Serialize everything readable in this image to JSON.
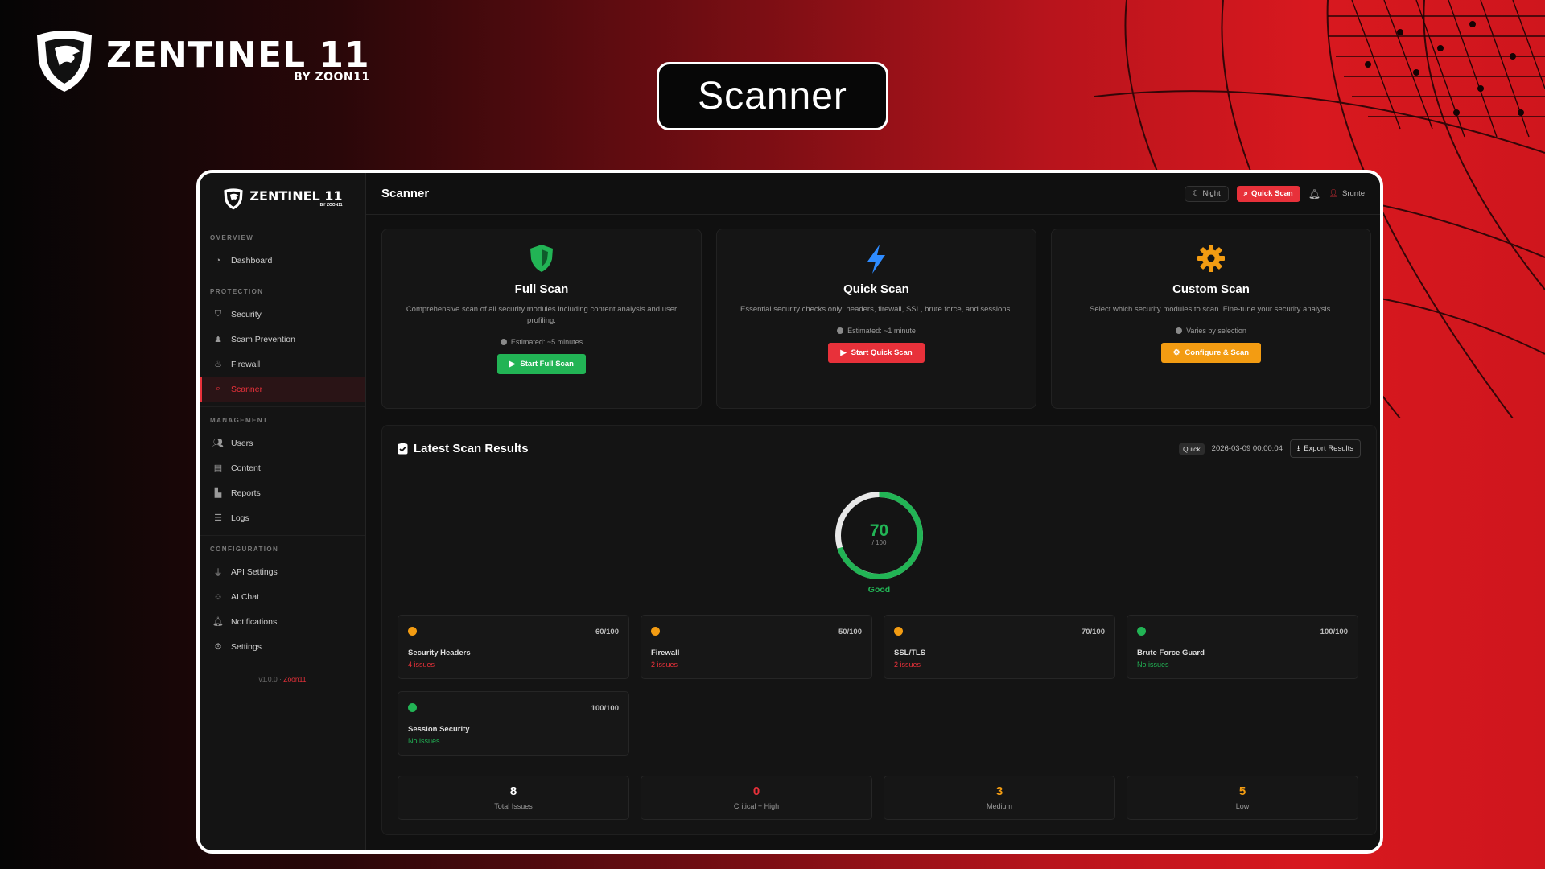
{
  "brand": {
    "name": "ZENTINEL 11",
    "sub": "BY ZOON11"
  },
  "hero_title": "Scanner",
  "sidebar": {
    "logo_name": "ZENTINEL 11",
    "logo_sub": "BY ZOON11",
    "sections": [
      {
        "heading": "OVERVIEW",
        "items": [
          {
            "label": "Dashboard",
            "icon": "dashboard-icon"
          }
        ]
      },
      {
        "heading": "PROTECTION",
        "items": [
          {
            "label": "Security",
            "icon": "shield-icon"
          },
          {
            "label": "Scam Prevention",
            "icon": "user-secret-icon"
          },
          {
            "label": "Firewall",
            "icon": "fire-icon"
          },
          {
            "label": "Scanner",
            "icon": "search-icon",
            "active": true
          }
        ]
      },
      {
        "heading": "MANAGEMENT",
        "items": [
          {
            "label": "Users",
            "icon": "users-icon"
          },
          {
            "label": "Content",
            "icon": "file-icon"
          },
          {
            "label": "Reports",
            "icon": "chart-icon"
          },
          {
            "label": "Logs",
            "icon": "list-icon"
          }
        ]
      },
      {
        "heading": "CONFIGURATION",
        "items": [
          {
            "label": "API Settings",
            "icon": "plug-icon"
          },
          {
            "label": "AI Chat",
            "icon": "robot-icon"
          },
          {
            "label": "Notifications",
            "icon": "bell-icon"
          },
          {
            "label": "Settings",
            "icon": "gear-icon"
          }
        ]
      }
    ],
    "version": "v1.0.0 ·",
    "version_link": "Zoon11"
  },
  "topbar": {
    "title": "Scanner",
    "night_label": "Night",
    "quick_scan_label": "Quick Scan",
    "user": "Srunte"
  },
  "scan_cards": [
    {
      "title": "Full Scan",
      "desc": "Comprehensive scan of all security modules including content analysis and user profiling.",
      "estimate": "Estimated: ~5 minutes",
      "button": "Start Full Scan",
      "color": "#22b455",
      "icon": "shield-icon"
    },
    {
      "title": "Quick Scan",
      "desc": "Essential security checks only: headers, firewall, SSL, brute force, and sessions.",
      "estimate": "Estimated: ~1 minute",
      "button": "Start Quick Scan",
      "color": "#e8313a",
      "icon": "bolt-icon"
    },
    {
      "title": "Custom Scan",
      "desc": "Select which security modules to scan. Fine-tune your security analysis.",
      "estimate": "Varies by selection",
      "button": "Configure & Scan",
      "color": "#f39c12",
      "icon": "gear-icon"
    }
  ],
  "results": {
    "title": "Latest Scan Results",
    "type_badge": "Quick",
    "timestamp": "2026-03-09 00:00:04",
    "export_label": "Export Results",
    "score": 70,
    "score_max": "/ 100",
    "score_fraction": 0.7,
    "rating": "Good",
    "modules": [
      {
        "name": "Security Headers",
        "score": "60/100",
        "issues": "4 issues",
        "status": "warning"
      },
      {
        "name": "Firewall",
        "score": "50/100",
        "issues": "2 issues",
        "status": "warning"
      },
      {
        "name": "SSL/TLS",
        "score": "70/100",
        "issues": "2 issues",
        "status": "warning"
      },
      {
        "name": "Brute Force Guard",
        "score": "100/100",
        "issues": "No issues",
        "status": "ok"
      },
      {
        "name": "Session Security",
        "score": "100/100",
        "issues": "No issues",
        "status": "ok"
      }
    ],
    "summary": [
      {
        "value": "8",
        "label": "Total Issues",
        "color": "#ffffff"
      },
      {
        "value": "0",
        "label": "Critical + High",
        "color": "#e8313a"
      },
      {
        "value": "3",
        "label": "Medium",
        "color": "#f39c12"
      },
      {
        "value": "5",
        "label": "Low",
        "color": "#f39c12"
      }
    ]
  },
  "colors": {
    "accent": "#e8313a",
    "ok": "#22b455",
    "warning": "#f39c12"
  }
}
